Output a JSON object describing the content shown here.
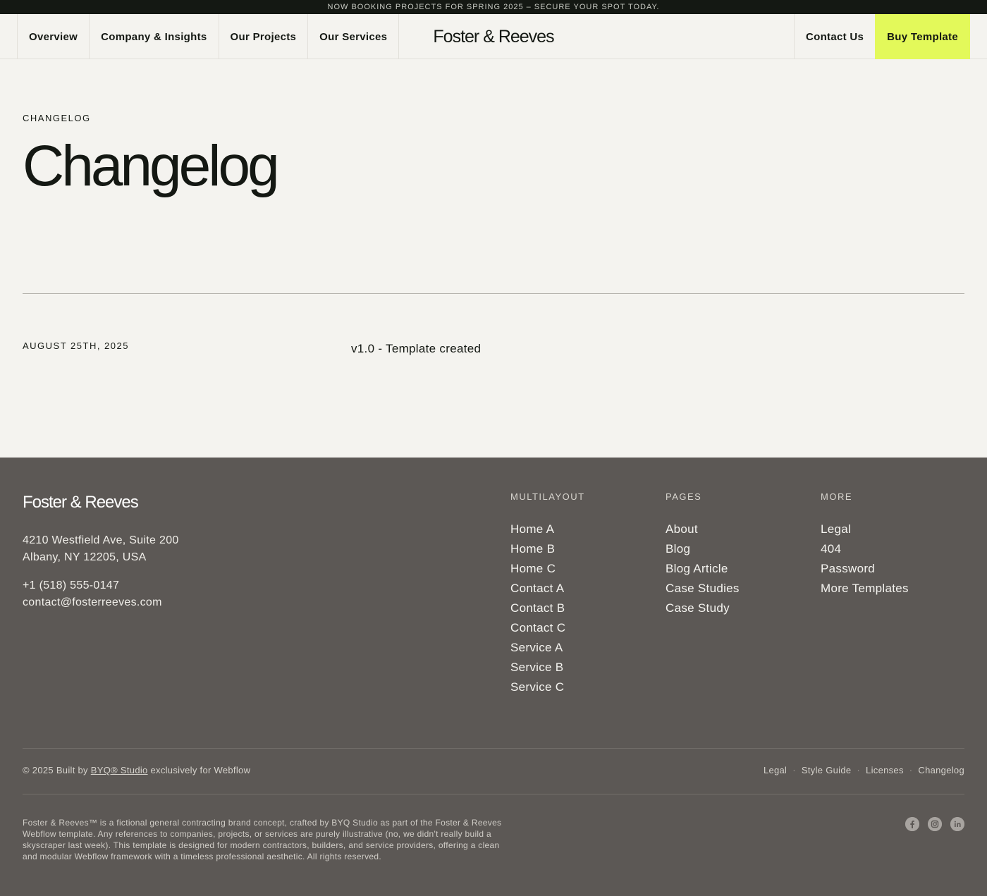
{
  "banner": {
    "text": "NOW BOOKING PROJECTS FOR SPRING 2025 – SECURE YOUR SPOT TODAY."
  },
  "nav": {
    "items": [
      "Overview",
      "Company & Insights",
      "Our Projects",
      "Our Services"
    ],
    "logo": "Foster & Reeves",
    "contact": "Contact Us",
    "buy": "Buy Template"
  },
  "hero": {
    "eyebrow": "CHANGELOG",
    "title": "Changelog"
  },
  "entry": {
    "date": "AUGUST 25TH, 2025",
    "text": "v1.0 - Template created"
  },
  "footer": {
    "logo": "Foster & Reeves",
    "address": [
      "4210 Westfield Ave, Suite 200",
      "Albany, NY 12205, USA"
    ],
    "phone": "+1 (518) 555-0147",
    "email": "contact@fosterreeves.com",
    "columns": [
      {
        "heading": "MULTILAYOUT",
        "links": [
          "Home A",
          "Home B",
          "Home C",
          "Contact A",
          "Contact B",
          "Contact C",
          "Service A",
          "Service B",
          "Service C"
        ]
      },
      {
        "heading": "PAGES",
        "links": [
          "About",
          "Blog",
          "Blog Article",
          "Case Studies",
          "Case Study"
        ]
      },
      {
        "heading": "MORE",
        "links": [
          "Legal",
          "404",
          "Password",
          "More Templates"
        ]
      }
    ],
    "copyright": {
      "prefix": "© 2025 Built by ",
      "link": "BYQ® Studio",
      "suffix": " exclusively for Webflow"
    },
    "bottom_links": [
      "Legal",
      "Style Guide",
      "Licenses",
      "Changelog"
    ],
    "disclaimer": "Foster & Reeves™ is a fictional general contracting brand concept, crafted by BYQ Studio as part of the Foster & Reeves Webflow template. Any references to companies, projects, or services are purely illustrative (no, we didn't really build a skyscraper last week). This template is designed for modern contractors, builders, and service providers, offering a clean and modular Webflow framework with a timeless professional aesthetic. All rights reserved.",
    "socials": [
      "facebook-icon",
      "instagram-icon",
      "linkedin-icon"
    ]
  },
  "colors": {
    "accent": "#e3f95a",
    "dark": "#141813",
    "footer_bg": "#5c5855",
    "page_bg": "#f4f3ef"
  }
}
